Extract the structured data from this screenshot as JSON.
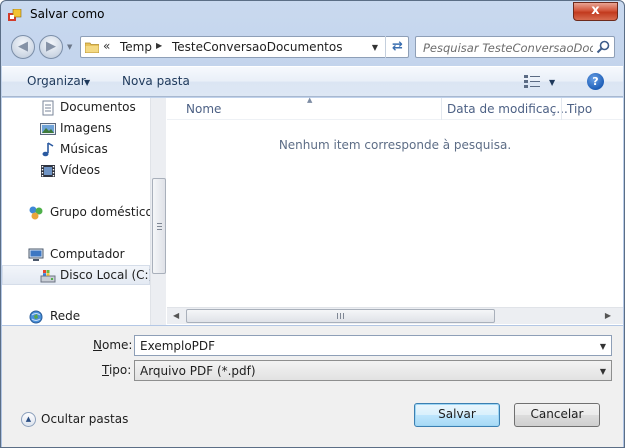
{
  "window": {
    "title": "Salvar como",
    "close_label": "x"
  },
  "address": {
    "chevron": "«",
    "crumbs": [
      "Temp",
      "TesteConversaoDocumentos"
    ],
    "search_placeholder": "Pesquisar TesteConversaoDoc..."
  },
  "toolbar": {
    "organizar_label": "Organizar",
    "nova_pasta_label": "Nova pasta",
    "help_label": "?"
  },
  "navpane": {
    "items": [
      {
        "label": "Documentos",
        "icon": "documents-icon"
      },
      {
        "label": "Imagens",
        "icon": "pictures-icon"
      },
      {
        "label": "Músicas",
        "icon": "music-icon"
      },
      {
        "label": "Vídeos",
        "icon": "videos-icon"
      },
      {
        "label": "Grupo doméstico",
        "icon": "homegroup-icon"
      },
      {
        "label": "Computador",
        "icon": "computer-icon"
      },
      {
        "label": "Disco Local (C:)",
        "icon": "local-disk-icon",
        "selected": true
      },
      {
        "label": "Rede",
        "icon": "network-icon"
      }
    ]
  },
  "filepane": {
    "columns": [
      "Nome",
      "Data de modificaç...",
      "Tipo"
    ],
    "empty_message": "Nenhum item corresponde à pesquisa."
  },
  "form": {
    "nome_label_u": "N",
    "nome_label_rest": "ome:",
    "nome_value": "ExemploPDF",
    "tipo_label_u": "T",
    "tipo_label_rest": "ipo:",
    "tipo_value": "Arquivo PDF (*.pdf)"
  },
  "footer": {
    "hide_folders_label": "Ocultar pastas",
    "save_label": "Salvar",
    "cancel_label": "Cancelar"
  },
  "colors": {
    "accent": "#3c7fb1",
    "close": "#c23a1e",
    "toolbar_text": "#1e395b"
  }
}
